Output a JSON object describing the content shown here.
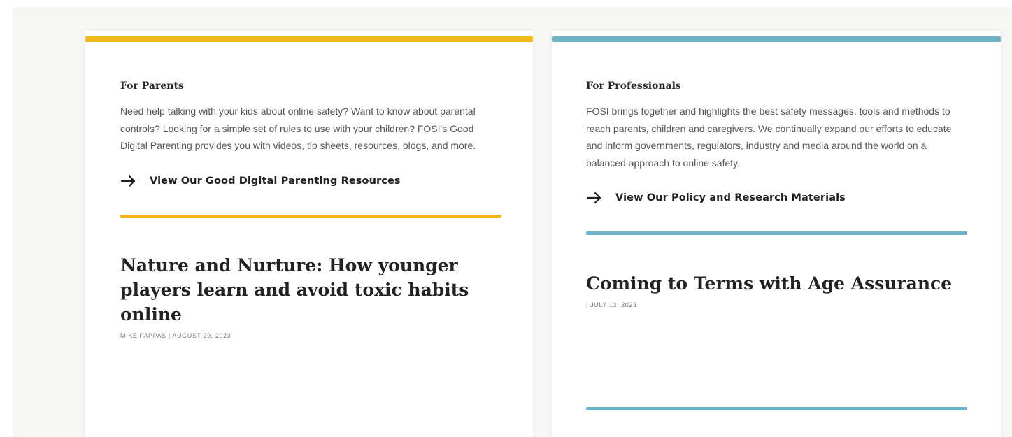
{
  "colors": {
    "parents_accent": "#f3b71b",
    "professionals_accent": "#6fb3c6"
  },
  "parents": {
    "eyebrow": "For Parents",
    "description": "Need help talking with your kids about online safety? Want to know about parental controls? Looking for a simple set of rules to use with your children? FOSI's Good Digital Parenting provides you with videos, tip sheets, resources, blogs, and more.",
    "cta_icon": "arrow-right-icon",
    "cta_label": "View Our Good Digital Parenting Resources",
    "article": {
      "title": "Nature and Nurture: How younger players learn and avoid toxic habits online",
      "byline": "MIKE PAPPAS | AUGUST 29, 2023"
    }
  },
  "professionals": {
    "eyebrow": "For Professionals",
    "description": "FOSI brings together and highlights the best safety messages, tools and methods to reach parents, children and caregivers. We continually expand our efforts to educate and inform governments, regulators, industry and media around the world on a balanced approach to online safety.",
    "cta_icon": "arrow-right-icon",
    "cta_label": "View Our Policy and Research Materials",
    "article": {
      "title": "Coming to Terms with Age Assurance",
      "byline": "| JULY 13, 2023"
    }
  }
}
